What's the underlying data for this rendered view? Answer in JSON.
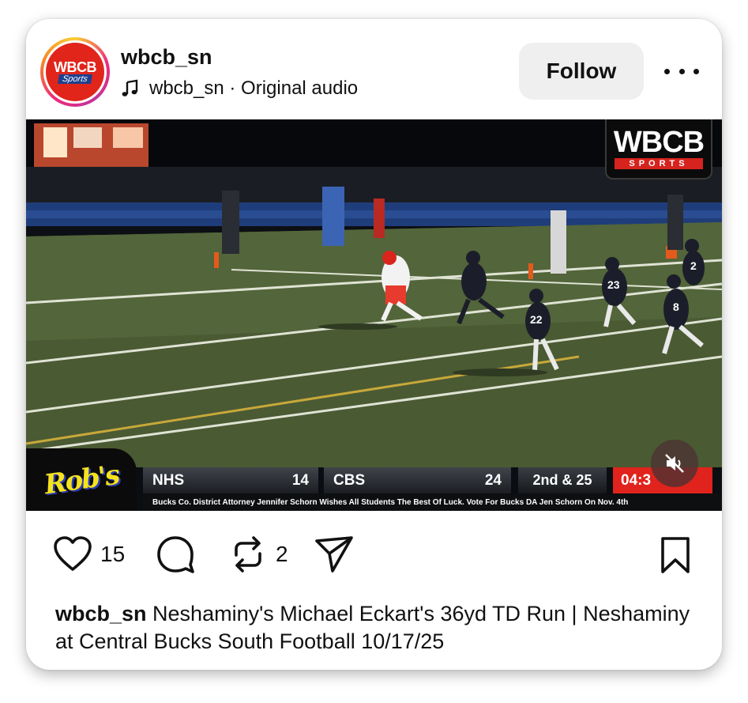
{
  "header": {
    "avatar_text_main": "WBCB",
    "avatar_text_sub": "Sports",
    "username": "wbcb_sn",
    "audio_text": "wbcb_sn · Original audio",
    "follow_label": "Follow",
    "more_icon": "more-horizontal-icon"
  },
  "video": {
    "logo_main": "WBCB",
    "logo_sub": "SPORTS",
    "sponsor": "Rob's",
    "home_team": "NHS",
    "home_score": "14",
    "away_team": "CBS",
    "away_score": "24",
    "down_distance": "2nd & 25",
    "clock": "04:3",
    "ticker": "Bucks Co. District Attorney Jennifer Schorn Wishes All Students The Best Of Luck. Vote For Bucks DA Jen Schorn On Nov. 4th",
    "jersey_numbers": [
      "22",
      "23",
      "8",
      "2"
    ],
    "mute_icon": "speaker-muted-icon"
  },
  "actions": {
    "like_icon": "heart-icon",
    "like_count": "15",
    "comment_icon": "comment-icon",
    "repost_icon": "repost-icon",
    "repost_count": "2",
    "share_icon": "send-icon",
    "save_icon": "bookmark-icon"
  },
  "caption": {
    "username": "wbcb_sn",
    "text": "Neshaminy's Michael Eckart's 36yd TD Run | Neshaminy at Central Bucks South Football 10/17/25"
  },
  "colors": {
    "accent_red": "#e0231c",
    "follow_bg": "#efefef",
    "field_green": "#4a5a33"
  }
}
